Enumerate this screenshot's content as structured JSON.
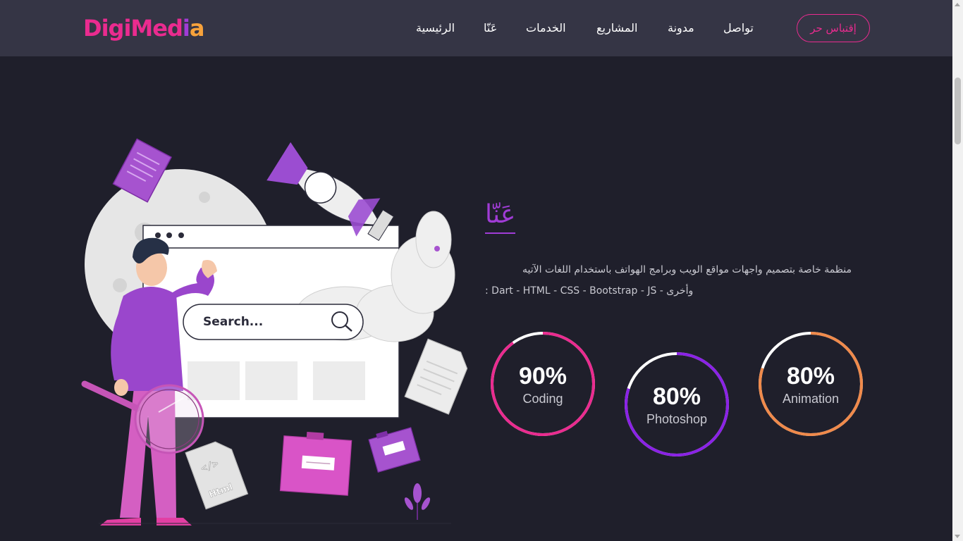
{
  "brand": {
    "logo_part1": "DigiMed",
    "logo_part2": "i",
    "logo_part3": "a",
    "colors": {
      "pink": "#ea2b8f",
      "purple": "#a03cd6",
      "orange": "#f7a23b",
      "navbar_bg": "#353545",
      "page_bg": "#1f1f2b"
    }
  },
  "nav": {
    "home": "الرئيسية",
    "about": "عَنّا",
    "services": "الخدمات",
    "projects": "المشاريع",
    "blog": "مدونة",
    "contact": "تواصل",
    "quote_button": "إقتباس حر"
  },
  "illustration": {
    "search_text": "Search...",
    "html_label": "Html",
    "code_glyph": "</>"
  },
  "about": {
    "title": "عَنّا",
    "description_line1": "منظمة خاصة بتصميم واجهات مواقع الويب وبرامج الهواتف باستخدام اللغات الآتيه",
    "description_line2": ": Dart - HTML - CSS - Bootstrap - JS - وأخرى"
  },
  "skills": [
    {
      "percent_text": "90%",
      "value": 0.9,
      "label": "Coding",
      "color": "#ea2b8f"
    },
    {
      "percent_text": "80%",
      "value": 0.8,
      "label": "Photoshop",
      "color": "#8a22e6"
    },
    {
      "percent_text": "80%",
      "value": 0.8,
      "label": "Animation",
      "color": "#f08a4b"
    }
  ]
}
